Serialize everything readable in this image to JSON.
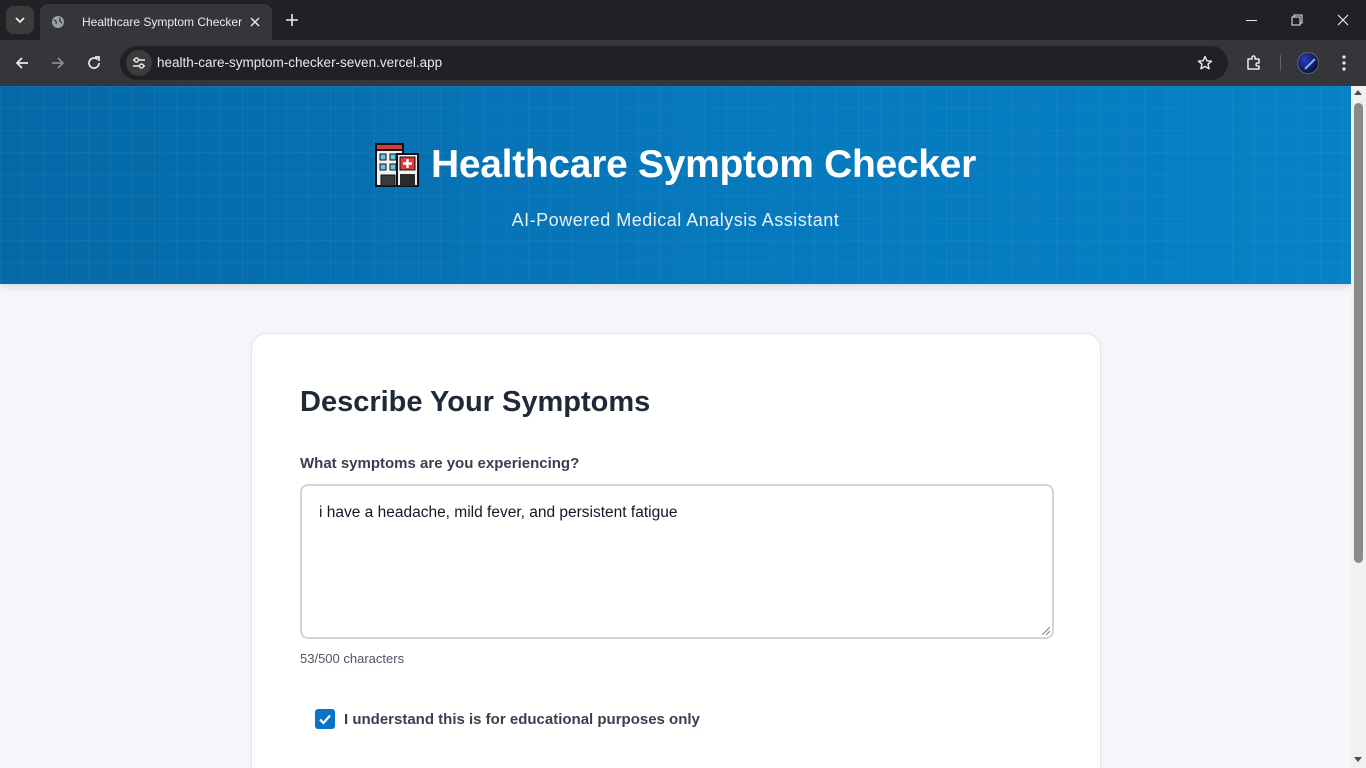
{
  "browser": {
    "tab_title": "Healthcare Symptom Checker",
    "url": "health-care-symptom-checker-seven.vercel.app"
  },
  "header": {
    "title": "Healthcare Symptom Checker",
    "subtitle": "AI-Powered Medical Analysis Assistant",
    "brand_color": "#0679bd"
  },
  "form": {
    "heading": "Describe Your Symptoms",
    "symptoms_label": "What symptoms are you experiencing?",
    "symptoms_value": "i have a headache, mild fever, and persistent fatigue",
    "char_count": "53/500 characters",
    "consent_label": "I understand this is for educational purposes only",
    "consent_checked": true
  },
  "icons": {
    "tab_search": "chevron-down-icon",
    "favicon": "globe-icon",
    "tab_close": "close-icon",
    "new_tab": "plus-icon",
    "back": "back-arrow-icon",
    "forward": "forward-arrow-icon",
    "reload": "reload-icon",
    "site_info": "tune-icon",
    "bookmark": "star-icon",
    "extensions": "puzzle-icon",
    "menu": "kebab-menu-icon",
    "header_logo": "hospital-icon"
  }
}
